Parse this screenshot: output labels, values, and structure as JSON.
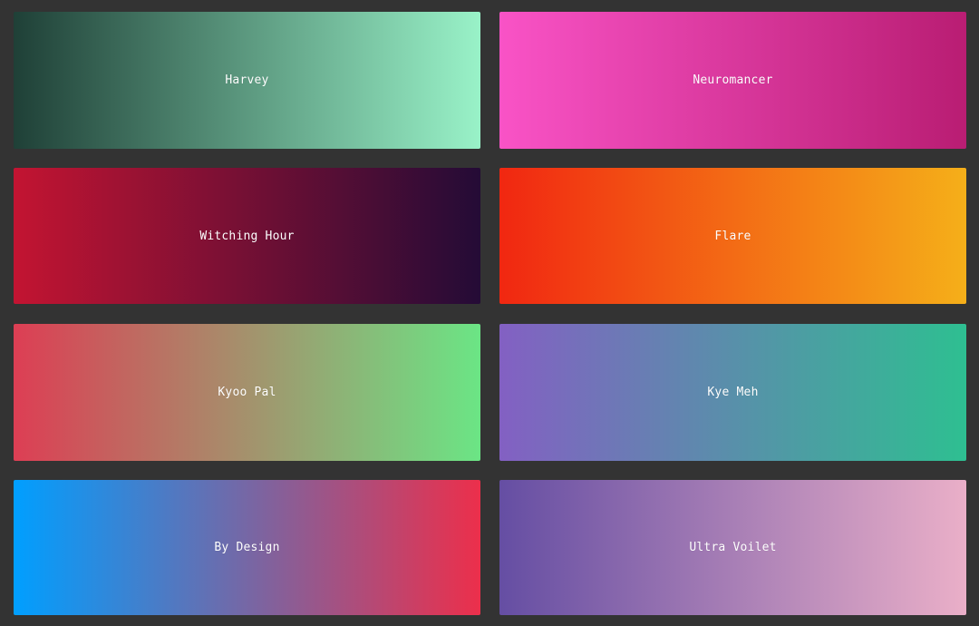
{
  "gradients": [
    {
      "name": "Harvey",
      "from": "#1f4037",
      "to": "#99f2c8"
    },
    {
      "name": "Neuromancer",
      "from": "#f953c6",
      "to": "#b91d73"
    },
    {
      "name": "Witching Hour",
      "from": "#c31432",
      "to": "#240b36"
    },
    {
      "name": "Flare",
      "from": "#f12711",
      "to": "#f5af19"
    },
    {
      "name": "Kyoo Pal",
      "from": "#dd3e54",
      "to": "#6be585"
    },
    {
      "name": "Kye Meh",
      "from": "#8360c3",
      "to": "#2ebf91"
    },
    {
      "name": "By Design",
      "from": "#009fff",
      "to": "#ec2f4b"
    },
    {
      "name": "Ultra Voilet",
      "from": "#654ea3",
      "to": "#eaafc8"
    }
  ]
}
